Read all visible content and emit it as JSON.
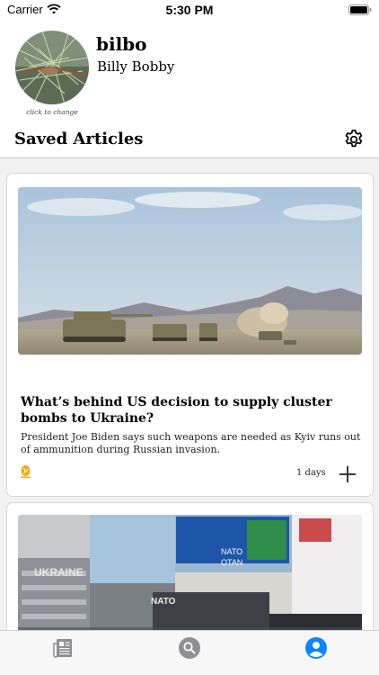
{
  "status_bar": {
    "carrier": "Carrier",
    "time": "5:30 PM",
    "icons": [
      "wifi-icon",
      "battery-icon"
    ]
  },
  "profile": {
    "username": "bilbo",
    "full_name": "Billy Bobby",
    "avatar_caption": "click to change"
  },
  "section": {
    "title": "Saved Articles",
    "settings_icon": "gear-icon"
  },
  "articles": [
    {
      "headline": "What’s behind US decision to supply cluster bombs to Ukraine?",
      "summary": "President Joe Biden says such weapons are needed as Kyiv runs out of ammunition during Russian invasion.",
      "age": "1 days",
      "source_icon": "al-jazeera-logo-icon",
      "action_icon": "plus-icon"
    },
    {
      "image_text": [
        "UKRAINE",
        "NATO",
        "NATO",
        "OTAN"
      ]
    }
  ],
  "tab_bar": {
    "tabs": [
      {
        "name": "feed",
        "icon": "newspaper-icon",
        "active": false
      },
      {
        "name": "search",
        "icon": "search-icon",
        "active": false
      },
      {
        "name": "profile",
        "icon": "person-icon",
        "active": true
      }
    ]
  },
  "colors": {
    "accent": "#0a84ff",
    "feed_background": "#f1f1f1",
    "inactive_tab": "#8e8e93",
    "source_logo": "#f2a81d"
  }
}
